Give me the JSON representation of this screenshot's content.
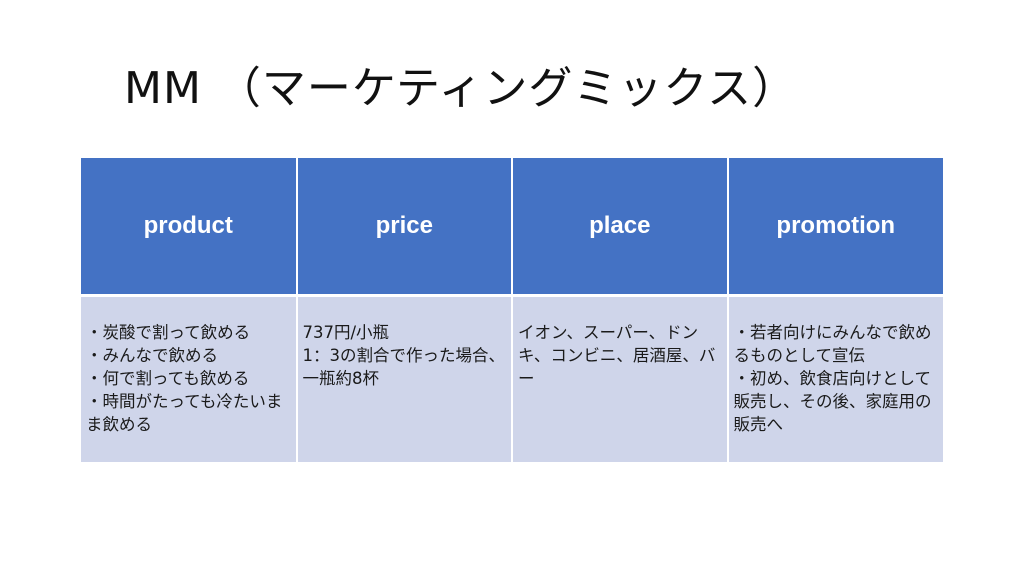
{
  "title": "MM （マーケティングミックス）",
  "table": {
    "headers": [
      "product",
      "price",
      "place",
      "promotion"
    ],
    "cells": [
      [
        "・炭酸で割って飲める",
        "・みんなで飲める",
        "・何で割っても飲める",
        "・時間がたっても冷たいまま飲める"
      ],
      [
        "737円/小瓶",
        "1：3の割合で作った場合、一瓶約8杯"
      ],
      [
        "イオン、スーパー、ドンキ、コンビニ、居酒屋、バー"
      ],
      [
        "・若者向けにみんなで飲めるものとして宣伝",
        "・初め、飲食店向けとして販売し、その後、家庭用の販売へ"
      ]
    ]
  },
  "colors": {
    "header_bg": "#4472c4",
    "body_bg": "#cfd5ea",
    "header_text": "#ffffff"
  }
}
